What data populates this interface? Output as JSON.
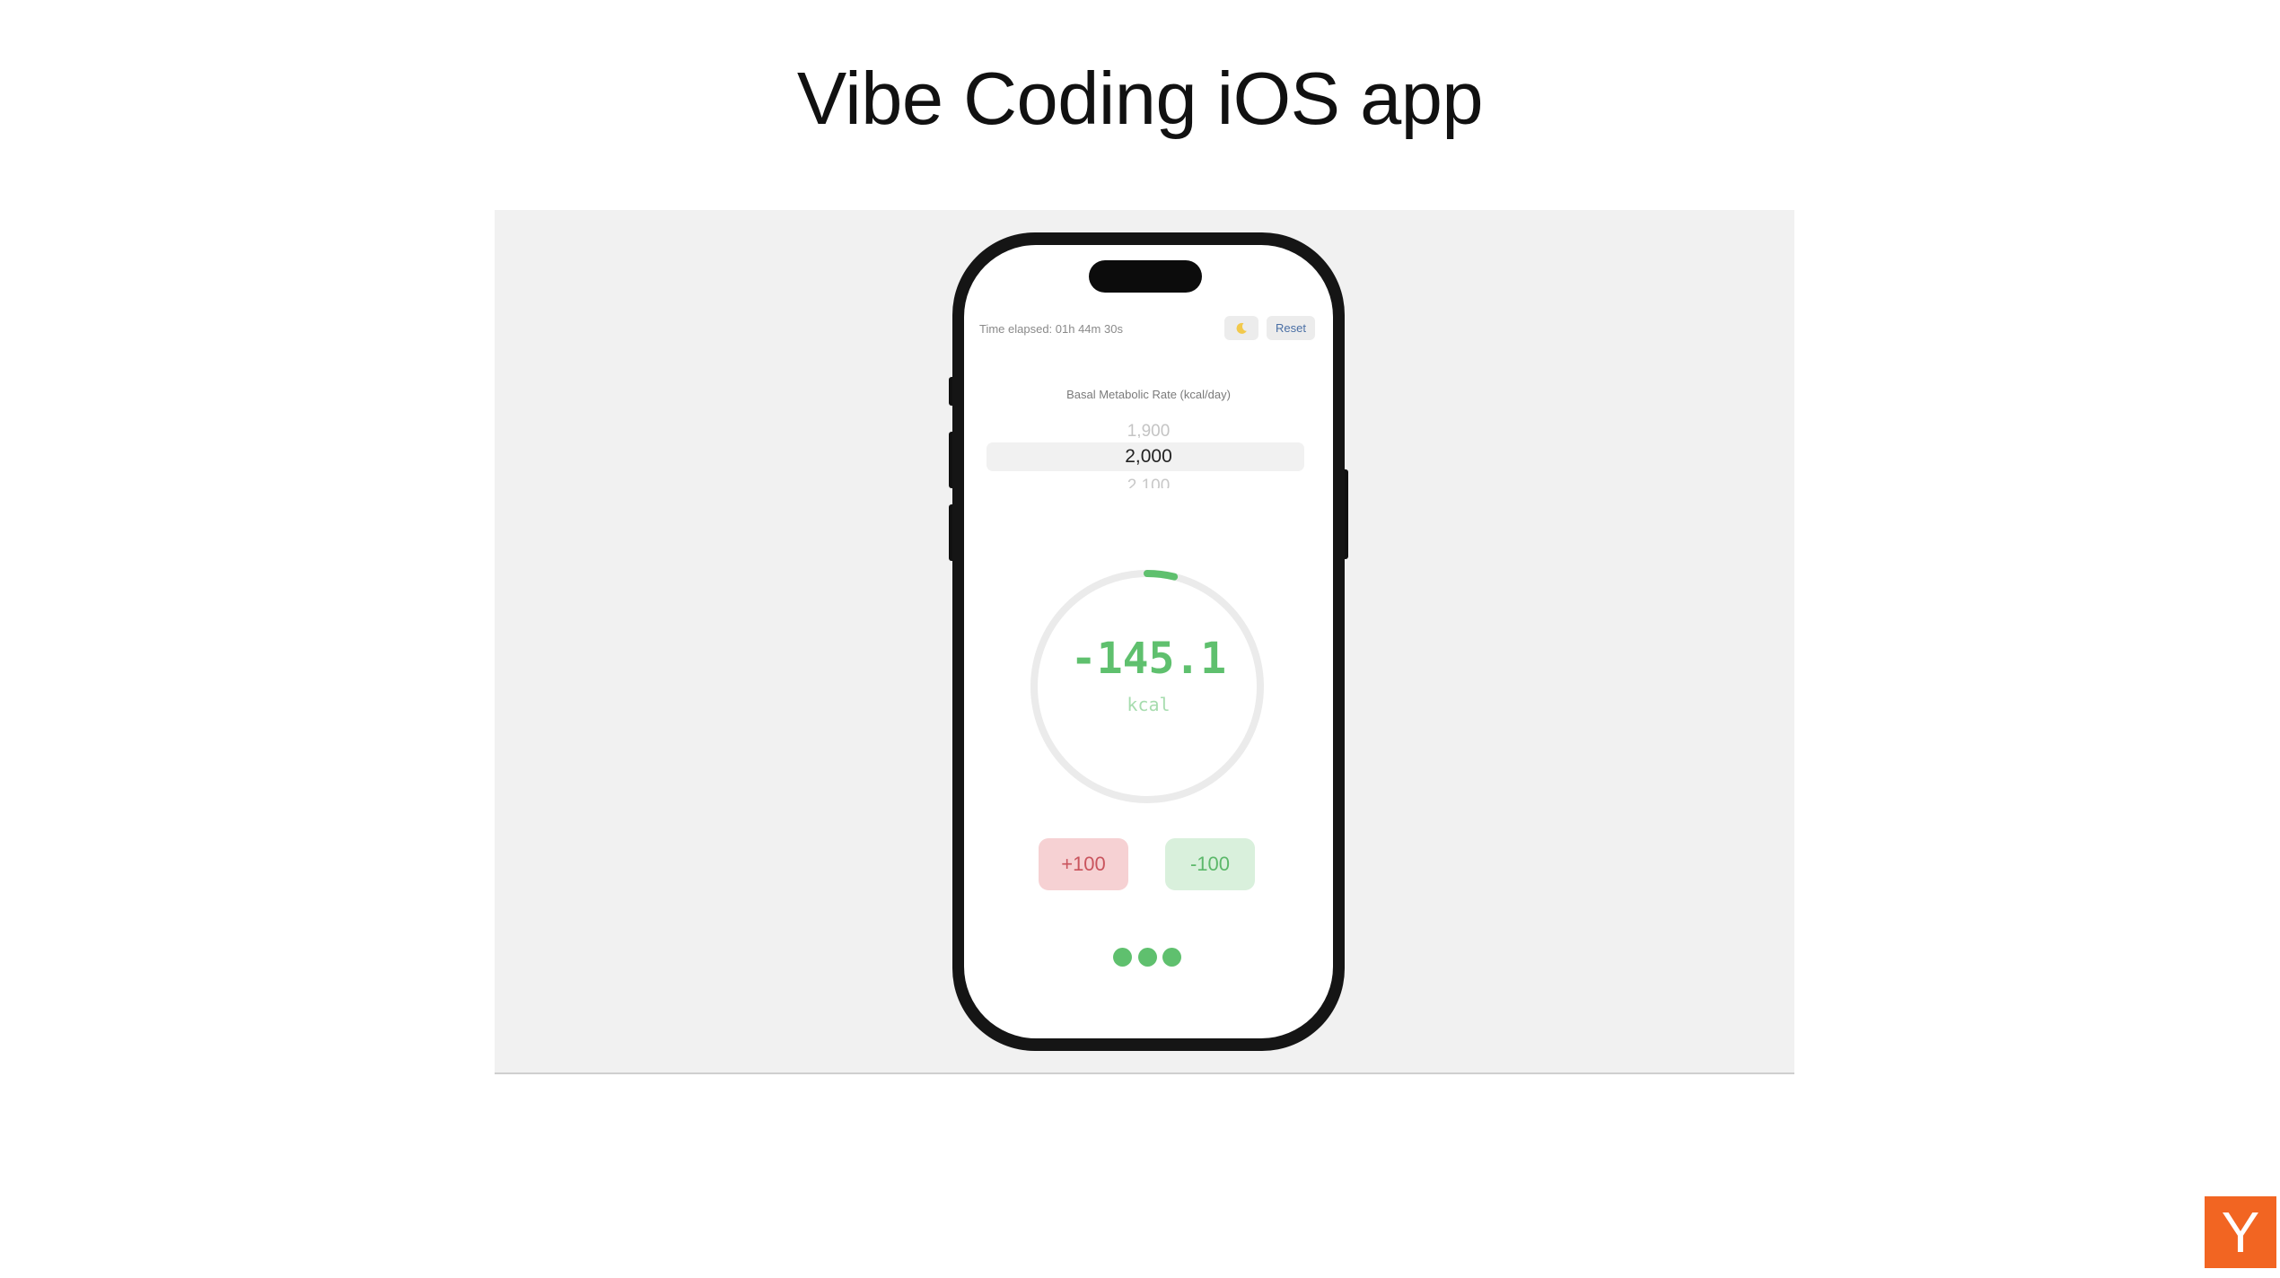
{
  "slide": {
    "title": "Vibe Coding iOS app"
  },
  "app": {
    "time_elapsed": "Time elapsed: 01h 44m 30s",
    "moon_icon": "moon-icon",
    "reset_label": "Reset",
    "bmr_label": "Basal Metabolic Rate (kcal/day)",
    "picker": {
      "previous": "1,900",
      "selected": "2,000",
      "next": "2,100"
    },
    "gauge": {
      "value": "-145.1",
      "unit": "kcal",
      "progress_fraction": 0.07
    },
    "buttons": {
      "plus_label": "+100",
      "minus_label": "-100"
    },
    "page_dots": 3
  },
  "colors": {
    "accent_green": "#5fc06e",
    "plus_bg": "#f6d1d3",
    "minus_bg": "#d9f0dc"
  },
  "watermark": {
    "logo_text": "Y"
  }
}
